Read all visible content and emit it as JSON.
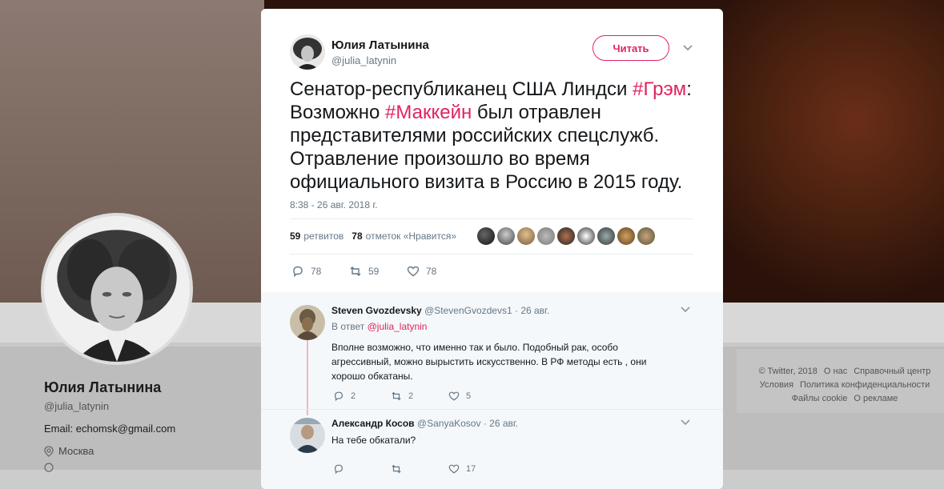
{
  "profile": {
    "name": "Юлия Латынина",
    "handle": "@julia_latynin",
    "email": "Email: echomsk@gmail.com",
    "location": "Москва"
  },
  "footer": {
    "items": [
      "© Twitter, 2018",
      "О нас",
      "Справочный центр",
      "Условия",
      "Политика конфиденциальности",
      "Файлы cookie",
      "О рекламе"
    ]
  },
  "tweet": {
    "name": "Юлия Латынина",
    "handle": "@julia_latynin",
    "follow_label": "Читать",
    "text_1": "Сенатор-республиканец США Линдси ",
    "tag_1": "#Грэм",
    "text_2": ": Возможно ",
    "tag_2": "#Маккейн",
    "text_3": " был отравлен представителями российских спецслужб. Отравление произошло во время официального визита в Россию в 2015 году.",
    "time": "8:38 - 26 авг. 2018 г.",
    "retweets_count": "59",
    "retweets_label": "ретвитов",
    "likes_count": "78",
    "likes_label": "отметок «Нравится»",
    "actions": {
      "replies": "78",
      "retweets": "59",
      "likes": "78"
    }
  },
  "replies": [
    {
      "name": "Steven Gvozdevsky",
      "handle": "@StevenGvozdevs1",
      "date": "· 26 авг.",
      "in_reply_prefix": "В ответ ",
      "in_reply_to": "@julia_latynin",
      "text": "Вполне возможно, что именно так и было. Подобный рак, особо агрессивный, можно вырыстить искусственно. В РФ методы есть , они хорошо обкатаны.",
      "replies": "2",
      "retweets": "2",
      "likes": "5"
    },
    {
      "name": "Александр Косов",
      "handle": "@SanyaKosov",
      "date": "· 26 авг.",
      "text": "На тебе обкатали?",
      "replies": "",
      "retweets": "",
      "likes": "17"
    }
  ],
  "colors": {
    "accent": "#e0245e",
    "muted": "#657786"
  }
}
